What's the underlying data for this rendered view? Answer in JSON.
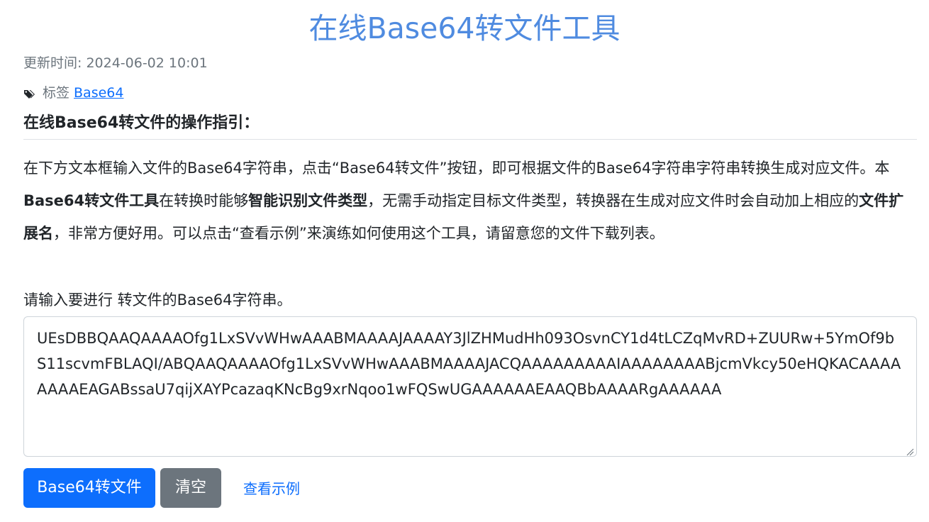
{
  "page": {
    "title": "在线Base64转文件工具",
    "update_time": "更新时间: 2024-06-02 10:01",
    "tags_label": "标签",
    "tag_link": "Base64",
    "tag_icon": "tags-icon"
  },
  "guide": {
    "title": "在线Base64转文件的操作指引：",
    "desc_part1": "在下方文本框输入文件的Base64字符串，点击“Base64转文件”按钮，即可根据文件的Base64字符串字符串转换生成对应文件。本",
    "desc_bold1": "Base64转文件工具",
    "desc_part2": "在转换时能够",
    "desc_bold2": "智能识别文件类型",
    "desc_part3": "，无需手动指定目标文件类型，转换器在生成对应文件时会自动加上相应的",
    "desc_bold3": "文件扩展名",
    "desc_part4": "，非常方便好用。可以点击“查看示例”来演练如何使用这个工具，请留意您的文件下载列表。"
  },
  "form": {
    "input_label": "请输入要进行 转文件的Base64字符串。",
    "textarea_value": "UEsDBBQAAQAAAAOfg1LxSVvWHwAAABMAAAAJAAAAY3JlZHMudHh093OsvnCY1d4tLCZqMvRD+ZUURw+5YmOf9bS11scvmFBLAQI/ABQAAQAAAAOfg1LxSVvWHwAAABMAAAAJACQAAAAAAAAAIAAAAAAAABjcmVkcy50eHQKACAAAAAAAAEAGABssaU7qijXAYPcazaqKNcBg9xrNqoo1wFQSwUGAAAAAAEAAQBbAAAARgAAAAAA"
  },
  "actions": {
    "convert_label": "Base64转文件",
    "clear_label": "清空",
    "example_label": "查看示例"
  },
  "colors": {
    "title": "#4f8be0",
    "primary": "#0d6efd",
    "secondary": "#6c757d",
    "link": "#0d6efd"
  }
}
